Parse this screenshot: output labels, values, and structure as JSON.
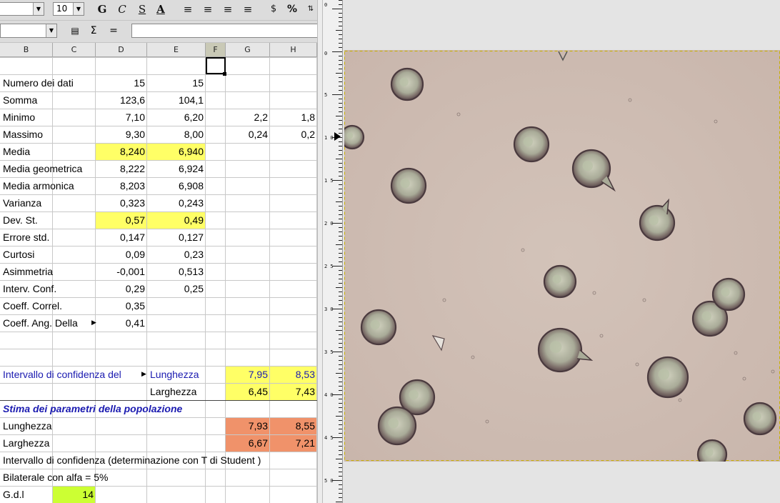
{
  "toolbar": {
    "font_size": "10",
    "buttons": [
      {
        "label": "G",
        "name": "bold-button"
      },
      {
        "label": "C",
        "name": "italic-button"
      },
      {
        "label": "S",
        "name": "underline-button"
      },
      {
        "label": "A",
        "name": "font-color-button"
      },
      {
        "label": "≡",
        "name": "align-left-icon"
      },
      {
        "label": "≡",
        "name": "align-center-icon"
      },
      {
        "label": "≡",
        "name": "align-right-icon"
      },
      {
        "label": "≡",
        "name": "justify-icon"
      },
      {
        "label": "$",
        "name": "currency-icon"
      },
      {
        "label": "%",
        "name": "percent-icon"
      }
    ]
  },
  "formula_bar": {
    "sigma": "Σ",
    "equals": "="
  },
  "columns": [
    "B",
    "C",
    "D",
    "E",
    "F",
    "G",
    "H"
  ],
  "rows": [
    {
      "B": "",
      "C": "",
      "D": "",
      "E": "",
      "G": "",
      "H": ""
    },
    {
      "B": "Numero dei dati",
      "D": "15",
      "E": "15"
    },
    {
      "B": "Somma",
      "D": "123,6",
      "E": "104,1"
    },
    {
      "B": "Minimo",
      "D": "7,10",
      "E": "6,20",
      "G": "2,2",
      "H": "1,8"
    },
    {
      "B": "Massimo",
      "D": "9,30",
      "E": "8,00",
      "G": "0,24",
      "H": "0,2"
    },
    {
      "B": "Media",
      "D": "8,240",
      "E": "6,940"
    },
    {
      "B": "Media geometrica",
      "D": "8,222",
      "E": "6,924"
    },
    {
      "B": "Media armonica",
      "D": "8,203",
      "E": "6,908"
    },
    {
      "B": "Varianza",
      "D": "0,323",
      "E": "0,243"
    },
    {
      "B": "Dev. St.",
      "D": "0,57",
      "E": "0,49"
    },
    {
      "B": "Errore std.",
      "D": "0,147",
      "E": "0,127"
    },
    {
      "B": "Curtosi",
      "D": "0,09",
      "E": "0,23"
    },
    {
      "B": "Asimmetria",
      "D": "-0,001",
      "E": "0,513"
    },
    {
      "B": "Interv. Conf.",
      "D": "0,29",
      "E": "0,25"
    },
    {
      "B": "Coeff. Correl.",
      "D": "0,35"
    },
    {
      "B": "Coeff. Ang. Della",
      "D": "0,41"
    },
    {
      "B": ""
    },
    {
      "B": ""
    },
    {
      "B": "Intervallo di confidenza del",
      "E": "Lunghezza",
      "G": "7,95",
      "H": "8,53"
    },
    {
      "B": "",
      "E": "Larghezza",
      "G": "6,45",
      "H": "7,43"
    },
    {
      "B": "Stima dei parametri della popolazione"
    },
    {
      "B": "Lunghezza",
      "G": "7,93",
      "H": "8,55"
    },
    {
      "B": "Larghezza",
      "G": "6,67",
      "H": "7,21"
    },
    {
      "B": "Intervallo di confidenza (determinazione con T di Student )"
    },
    {
      "B": "Bilaterale con alfa = 5%"
    },
    {
      "B": "G.d.l",
      "C": "14"
    }
  ],
  "colors": {
    "yellow": "#ffff66",
    "lime": "#ccff33",
    "orange": "#f0926a",
    "blue_text": "#1a1ab0"
  },
  "ruler": {
    "labels": [
      "0",
      "0",
      "5",
      "1 0",
      "1 5",
      "2 0",
      "2 5",
      "3 0",
      "3 5",
      "4 0",
      "4 5",
      "5 0"
    ]
  }
}
